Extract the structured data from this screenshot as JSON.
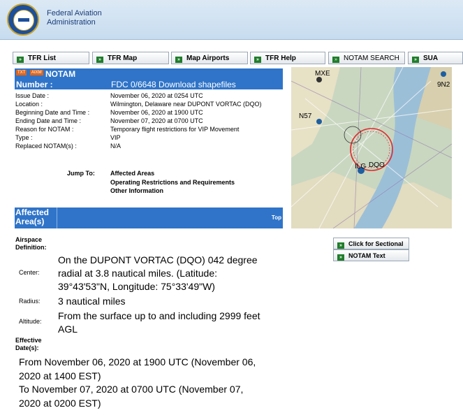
{
  "header": {
    "agency_line1": "Federal Aviation",
    "agency_line2": "Administration",
    "seal_icon": "faa-seal-icon"
  },
  "nav": [
    {
      "label": "TFR List"
    },
    {
      "label": "TFR Map"
    },
    {
      "label": "Map Airports"
    },
    {
      "label": "TFR Help"
    },
    {
      "label": "NOTAM SEARCH"
    },
    {
      "label": "SUA"
    }
  ],
  "notam": {
    "tag1": "TXT",
    "tag2": "AIXM",
    "title": "NOTAM",
    "number_label": "Number :",
    "number_value": "FDC 0/6648",
    "download_link": "Download shapefiles",
    "details": [
      {
        "label": "Issue Date :",
        "value": "November 06, 2020 at 0254 UTC"
      },
      {
        "label": "Location :",
        "value": "Wilmington, Delaware near DUPONT VORTAC (DQO)"
      },
      {
        "label": "Beginning Date and Time :",
        "value": "November 06, 2020 at 1900 UTC"
      },
      {
        "label": "Ending Date and Time :",
        "value": "November 07, 2020 at 0700 UTC"
      },
      {
        "label": "Reason for NOTAM :",
        "value": "Temporary flight restrictions for VIP Movement"
      },
      {
        "label": "Type :",
        "value": "VIP"
      },
      {
        "label": "Replaced NOTAM(s) :",
        "value": "N/A"
      }
    ],
    "jump_label": "Jump To:",
    "jump_links": [
      "Affected Areas",
      "Operating Restrictions and Requirements",
      "Other Information"
    ]
  },
  "affected": {
    "heading_line1": "Affected",
    "heading_line2": "Area(s)",
    "top_link": "Top",
    "airspace_label_line1": "Airspace",
    "airspace_label_line2": "Definition:",
    "center_label": "Center:",
    "center_lines": [
      "On the DUPONT VORTAC (DQO) 042 degree",
      "radial at 3.8 nautical miles. (Latitude:",
      "39°43'53\"N, Longitude: 75°33'49\"W)"
    ],
    "radius_label": "Radius:",
    "radius_value": "3 nautical miles",
    "altitude_label": "Altitude:",
    "altitude_lines": [
      "From the surface up to and including 2999 feet",
      "AGL"
    ],
    "effective_label_line1": "Effective",
    "effective_label_line2": "Date(s):",
    "effective_lines": [
      "From November 06, 2020 at 1900 UTC (November 06,",
      "2020 at 1400 EST)",
      "To November 07, 2020 at 0700 UTC (November 07,",
      "2020 at 0200 EST)"
    ]
  },
  "map": {
    "labels": [
      "MXE",
      "9N2",
      "N57",
      "ILG",
      "DQO"
    ]
  },
  "side_buttons": [
    {
      "label": "Click for Sectional"
    },
    {
      "label": "NOTAM Text"
    }
  ]
}
